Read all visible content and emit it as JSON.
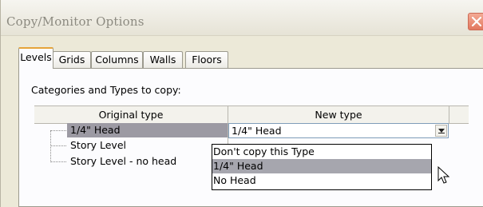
{
  "window": {
    "title": "Copy/Monitor Options",
    "close_icon": "close-icon"
  },
  "tabs": [
    {
      "label": "Levels",
      "active": true
    },
    {
      "label": "Grids",
      "active": false
    },
    {
      "label": "Columns",
      "active": false
    },
    {
      "label": "Walls",
      "active": false
    },
    {
      "label": "Floors",
      "active": false
    }
  ],
  "panel": {
    "section_label": "Categories and Types to copy:"
  },
  "grid": {
    "columns": [
      "Original type",
      "New type"
    ],
    "rows": [
      {
        "original": "1/4\" Head",
        "new": "1/4\" Head",
        "selected": true
      },
      {
        "original": "Story Level",
        "new": ""
      },
      {
        "original": "Story Level - no head",
        "new": ""
      }
    ]
  },
  "dropdown": {
    "options": [
      "Don't copy this Type",
      "1/4\" Head",
      "No Head"
    ],
    "highlighted_index": 1
  }
}
